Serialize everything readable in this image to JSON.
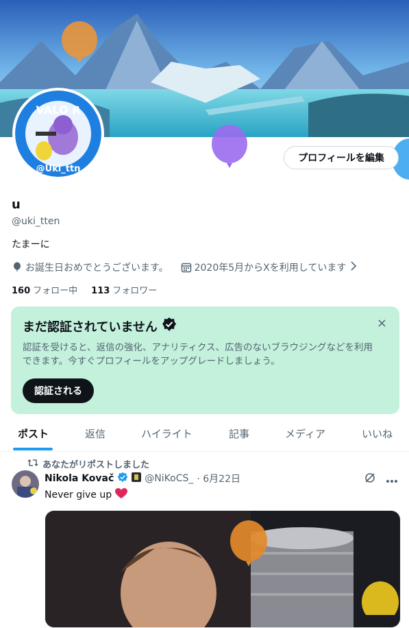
{
  "profile": {
    "name": "u",
    "handle": "@uki_tten",
    "bio": "たまーに",
    "birthday": "お誕生日おめでとうございます。",
    "joined": "2020年5月からXを利用しています",
    "edit_button": "プロフィールを編集",
    "following_count": "160",
    "following_label": "フォロー中",
    "followers_count": "113",
    "followers_label": "フォロワー",
    "avatar_text_top": "VALO R",
    "avatar_text_bottom": "@Uki_ttn"
  },
  "verify_card": {
    "title": "まだ認証されていません",
    "description": "認証を受けると、返信の強化、アナリティクス、広告のないブラウジングなどを利用できます。今すぐプロフィールをアップグレードしましょう。",
    "button": "認証される",
    "close": "×"
  },
  "tabs": [
    "ポスト",
    "返信",
    "ハイライト",
    "記事",
    "メディア",
    "いいね"
  ],
  "post": {
    "repost_note": "あなたがリポストしました",
    "author": "Nikola Kovač",
    "handle": "@NiKoCS_",
    "date": "· 6月22日",
    "text": "Never give up"
  },
  "colors": {
    "accent": "#1d9bf0",
    "verify_bg": "#c3f1dc",
    "text_primary": "#0f1419",
    "text_secondary": "#536471"
  }
}
